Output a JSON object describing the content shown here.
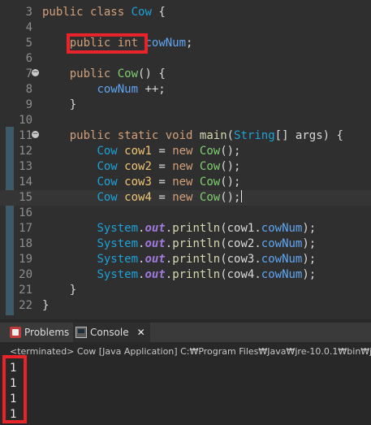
{
  "editor": {
    "lines": [
      {
        "n": "3",
        "tokens": [
          [
            "kw",
            "public "
          ],
          [
            "kw",
            "class "
          ],
          [
            "typ",
            "Cow"
          ],
          [
            "pl",
            " {"
          ]
        ]
      },
      {
        "n": "4",
        "tokens": []
      },
      {
        "n": "5",
        "tokens": [
          [
            "pl",
            "    "
          ],
          [
            "kw",
            "public "
          ],
          [
            "kw",
            "int"
          ],
          [
            "pl",
            " "
          ],
          [
            "fld",
            "cowNum"
          ],
          [
            "pl",
            ";"
          ]
        ]
      },
      {
        "n": "6",
        "tokens": []
      },
      {
        "n": "7",
        "fold": true,
        "tokens": [
          [
            "pl",
            "    "
          ],
          [
            "kw",
            "public "
          ],
          [
            "ctor",
            "Cow"
          ],
          [
            "pl",
            "() {"
          ]
        ]
      },
      {
        "n": "8",
        "tokens": [
          [
            "pl",
            "        "
          ],
          [
            "fld",
            "cowNum"
          ],
          [
            "pl",
            " ++;"
          ]
        ]
      },
      {
        "n": "9",
        "tokens": [
          [
            "pl",
            "    }"
          ]
        ]
      },
      {
        "n": "10",
        "tokens": []
      },
      {
        "n": "11",
        "fold": true,
        "tokens": [
          [
            "pl",
            "    "
          ],
          [
            "kw",
            "public "
          ],
          [
            "kw",
            "static "
          ],
          [
            "kw",
            "void "
          ],
          [
            "mth",
            "main"
          ],
          [
            "pl",
            "("
          ],
          [
            "typ",
            "String"
          ],
          [
            "pl",
            "[] args) {"
          ]
        ]
      },
      {
        "n": "12",
        "tokens": [
          [
            "pl",
            "        "
          ],
          [
            "typ",
            "Cow"
          ],
          [
            "pl",
            " "
          ],
          [
            "var",
            "cow1"
          ],
          [
            "pl",
            " = "
          ],
          [
            "kw",
            "new "
          ],
          [
            "ctor",
            "Cow"
          ],
          [
            "pl",
            "();"
          ]
        ]
      },
      {
        "n": "13",
        "tokens": [
          [
            "pl",
            "        "
          ],
          [
            "typ",
            "Cow"
          ],
          [
            "pl",
            " "
          ],
          [
            "var",
            "cow2"
          ],
          [
            "pl",
            " = "
          ],
          [
            "kw",
            "new "
          ],
          [
            "ctor",
            "Cow"
          ],
          [
            "pl",
            "();"
          ]
        ]
      },
      {
        "n": "14",
        "tokens": [
          [
            "pl",
            "        "
          ],
          [
            "typ",
            "Cow"
          ],
          [
            "pl",
            " "
          ],
          [
            "var",
            "cow3"
          ],
          [
            "pl",
            " = "
          ],
          [
            "kw",
            "new "
          ],
          [
            "ctor",
            "Cow"
          ],
          [
            "pl",
            "();"
          ]
        ]
      },
      {
        "n": "15",
        "current": true,
        "tokens": [
          [
            "pl",
            "        "
          ],
          [
            "typ",
            "Cow"
          ],
          [
            "pl",
            " "
          ],
          [
            "var",
            "cow4"
          ],
          [
            "pl",
            " = "
          ],
          [
            "kw",
            "new "
          ],
          [
            "ctor",
            "Cow"
          ],
          [
            "pl",
            "();"
          ]
        ]
      },
      {
        "n": "16",
        "tokens": []
      },
      {
        "n": "17",
        "tokens": [
          [
            "pl",
            "        "
          ],
          [
            "typ",
            "System"
          ],
          [
            "pl",
            "."
          ],
          [
            "stat",
            "out"
          ],
          [
            "pl",
            "."
          ],
          [
            "mth",
            "println"
          ],
          [
            "pl",
            "(cow1."
          ],
          [
            "fld",
            "cowNum"
          ],
          [
            "pl",
            ");"
          ]
        ]
      },
      {
        "n": "18",
        "tokens": [
          [
            "pl",
            "        "
          ],
          [
            "typ",
            "System"
          ],
          [
            "pl",
            "."
          ],
          [
            "stat",
            "out"
          ],
          [
            "pl",
            "."
          ],
          [
            "mth",
            "println"
          ],
          [
            "pl",
            "(cow2."
          ],
          [
            "fld",
            "cowNum"
          ],
          [
            "pl",
            ");"
          ]
        ]
      },
      {
        "n": "19",
        "tokens": [
          [
            "pl",
            "        "
          ],
          [
            "typ",
            "System"
          ],
          [
            "pl",
            "."
          ],
          [
            "stat",
            "out"
          ],
          [
            "pl",
            "."
          ],
          [
            "mth",
            "println"
          ],
          [
            "pl",
            "(cow3."
          ],
          [
            "fld",
            "cowNum"
          ],
          [
            "pl",
            ");"
          ]
        ]
      },
      {
        "n": "20",
        "tokens": [
          [
            "pl",
            "        "
          ],
          [
            "typ",
            "System"
          ],
          [
            "pl",
            "."
          ],
          [
            "stat",
            "out"
          ],
          [
            "pl",
            "."
          ],
          [
            "mth",
            "println"
          ],
          [
            "pl",
            "(cow4."
          ],
          [
            "fld",
            "cowNum"
          ],
          [
            "pl",
            ");"
          ]
        ]
      },
      {
        "n": "21",
        "tokens": [
          [
            "pl",
            "    }"
          ]
        ]
      },
      {
        "n": "22",
        "tokens": [
          [
            "pl",
            "}"
          ]
        ]
      }
    ]
  },
  "panel": {
    "tabs": {
      "problems": "Problems",
      "console": "Console"
    },
    "status": "<terminated> Cow [Java Application] C:₩Program Files₩Java₩jre-10.0.1₩bin₩javaw.exe",
    "output": [
      "1",
      "1",
      "1",
      "1"
    ]
  },
  "colors": {
    "highlight_box": "#e8242a",
    "background": "#2f2f2f"
  },
  "icons": {
    "problems": "problems-icon",
    "console": "console-icon",
    "close": "close-icon",
    "fold": "fold-collapse-icon"
  }
}
